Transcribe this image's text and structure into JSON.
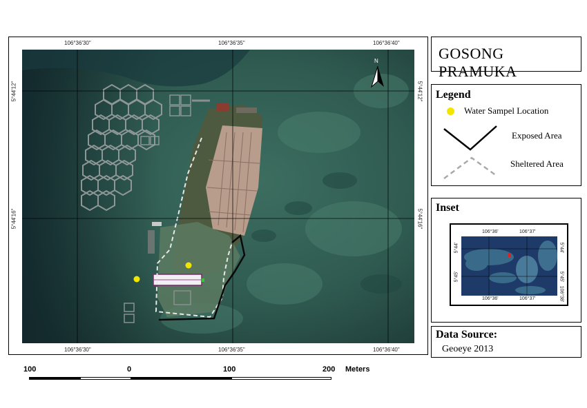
{
  "title": "GOSONG PRAMUKA",
  "legend": {
    "heading": "Legend",
    "items": [
      {
        "label": "Water Sampel Location",
        "symbol": "yellow-dot",
        "color": "#f2e600"
      },
      {
        "label": "Exposed Area",
        "symbol": "solid-zigzag",
        "color": "#000000"
      },
      {
        "label": "Sheltered Area",
        "symbol": "dashed-zigzag",
        "color": "#a9a9a9"
      }
    ]
  },
  "inset": {
    "heading": "Inset",
    "top_labels": [
      "106°36'",
      "106°37'"
    ],
    "bottom_labels": [
      "106°36'",
      "106°37'"
    ],
    "left_labels": [
      "5°44'",
      "5°45'"
    ],
    "right_labels": [
      "5°44'",
      "5°45'",
      "106°38'"
    ],
    "marker_color": "#e0201c"
  },
  "data_source": {
    "heading": "Data Source:",
    "value": "Geoeye 2013"
  },
  "map": {
    "top_labels": [
      "106°36'30\"",
      "106°36'35\"",
      "106°36'40\""
    ],
    "bottom_labels": [
      "106°36'30\"",
      "106°36'35\"",
      "106°36'40\""
    ],
    "left_labels": [
      "5°44'12\"",
      "5°44'16\""
    ],
    "right_labels": [
      "5°44'12\"",
      "5°44'16\""
    ],
    "north_label": "N"
  },
  "scale_bar": {
    "labels": [
      "100",
      "0",
      "100",
      "200"
    ],
    "unit": "Meters"
  }
}
